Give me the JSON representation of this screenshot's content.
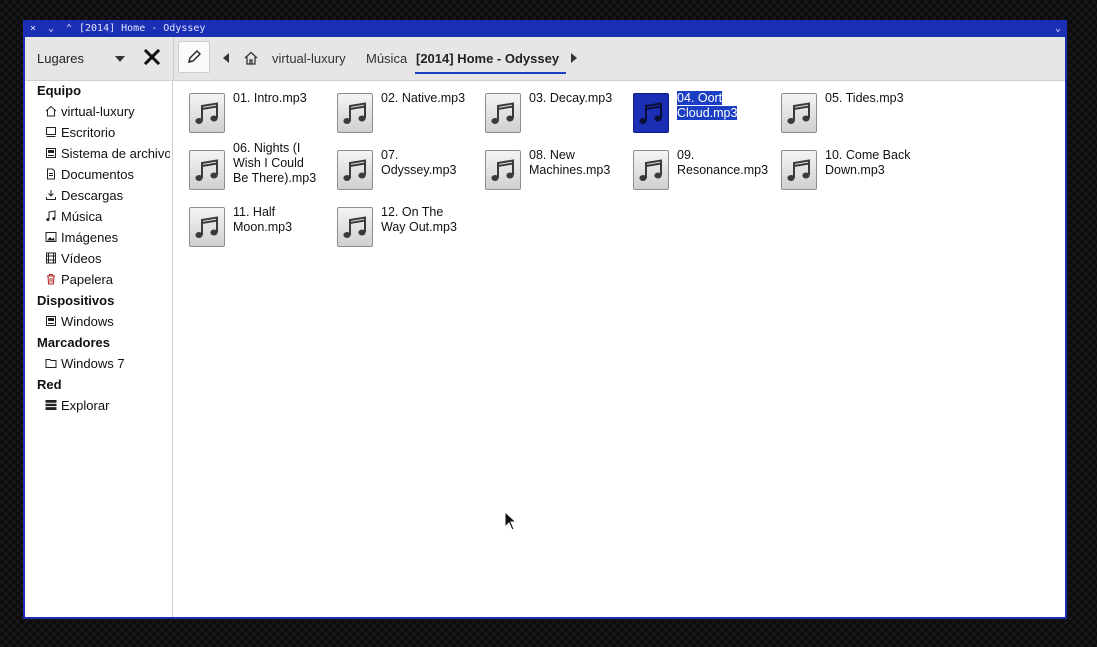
{
  "window": {
    "title": "[2014] Home - Odyssey"
  },
  "titlebar": {
    "close": "×",
    "minimize": "⌄",
    "maximize": "⌃",
    "menu": "⌄"
  },
  "toolbar": {
    "places_label": "Lugares",
    "breadcrumbs": [
      "virtual-luxury",
      "Música",
      "[2014] Home - Odyssey"
    ]
  },
  "sidebar": {
    "sections": [
      {
        "title": "Equipo",
        "items": [
          {
            "label": "virtual-luxury",
            "icon": "home-icon"
          },
          {
            "label": "Escritorio",
            "icon": "desktop-icon"
          },
          {
            "label": "Sistema de archivos",
            "icon": "drive-icon"
          },
          {
            "label": "Documentos",
            "icon": "document-icon"
          },
          {
            "label": "Descargas",
            "icon": "download-icon"
          },
          {
            "label": "Música",
            "icon": "music-icon"
          },
          {
            "label": "Imágenes",
            "icon": "image-icon"
          },
          {
            "label": "Vídeos",
            "icon": "video-icon"
          },
          {
            "label": "Papelera",
            "icon": "trash-icon"
          }
        ]
      },
      {
        "title": "Dispositivos",
        "items": [
          {
            "label": "Windows",
            "icon": "drive-icon"
          }
        ]
      },
      {
        "title": "Marcadores",
        "items": [
          {
            "label": "Windows 7",
            "icon": "folder-icon"
          }
        ]
      },
      {
        "title": "Red",
        "items": [
          {
            "label": "Explorar",
            "icon": "network-icon"
          }
        ]
      }
    ]
  },
  "files": [
    {
      "name": "01. Intro.mp3",
      "selected": false
    },
    {
      "name": "02. Native.mp3",
      "selected": false
    },
    {
      "name": "03. Decay.mp3",
      "selected": false
    },
    {
      "name": "04. Oort Cloud.mp3",
      "selected": true
    },
    {
      "name": "05. Tides.mp3",
      "selected": false
    },
    {
      "name": "06. Nights (I Wish I Could Be There).mp3",
      "selected": false
    },
    {
      "name": "07. Odyssey.mp3",
      "selected": false
    },
    {
      "name": "08. New Machines.mp3",
      "selected": false
    },
    {
      "name": "09. Resonance.mp3",
      "selected": false
    },
    {
      "name": "10. Come Back Down.mp3",
      "selected": false
    },
    {
      "name": "11. Half Moon.mp3",
      "selected": false
    },
    {
      "name": "12. On The Way Out.mp3",
      "selected": false
    }
  ],
  "colors": {
    "accent": "#1b3fc4",
    "frame": "#1b2fb5"
  }
}
